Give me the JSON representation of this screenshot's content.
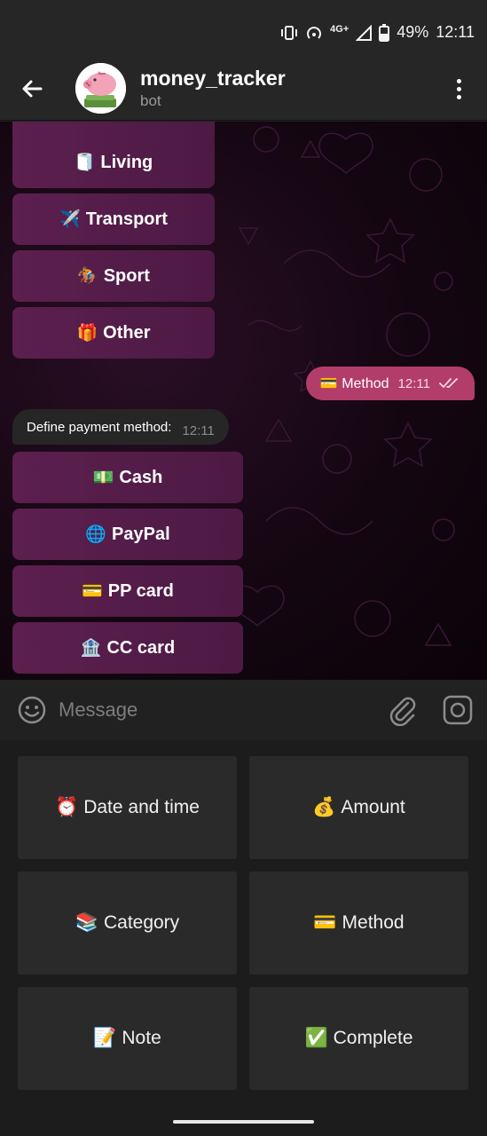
{
  "status_bar": {
    "network": "4G+",
    "battery": "49%",
    "time": "12:11"
  },
  "header": {
    "title": "money_tracker",
    "subtitle": "bot"
  },
  "chat": {
    "category_buttons": [
      {
        "emoji": "🧻",
        "label": "Living"
      },
      {
        "emoji": "✈️",
        "label": "Transport"
      },
      {
        "emoji": "🏇",
        "label": "Sport"
      },
      {
        "emoji": "🎁",
        "label": "Other"
      }
    ],
    "outgoing": {
      "emoji": "💳",
      "text": "Method",
      "time": "12:11"
    },
    "incoming": {
      "text": "Define payment method:",
      "time": "12:11"
    },
    "payment_buttons": [
      {
        "emoji": "💵",
        "label": "Cash"
      },
      {
        "emoji": "🌐",
        "label": "PayPal"
      },
      {
        "emoji": "💳",
        "label": "PP card"
      },
      {
        "emoji": "🏦",
        "label": "CC card"
      }
    ]
  },
  "input": {
    "placeholder": "Message"
  },
  "keyboard": [
    {
      "emoji": "⏰",
      "label": "Date and time"
    },
    {
      "emoji": "💰",
      "label": "Amount"
    },
    {
      "emoji": "📚",
      "label": "Category"
    },
    {
      "emoji": "💳",
      "label": "Method"
    },
    {
      "emoji": "📝",
      "label": "Note"
    },
    {
      "emoji": "✅",
      "label": "Complete"
    }
  ],
  "icons": [
    "back-arrow-icon",
    "piggy-bank-avatar",
    "more-vert-icon",
    "vibrate-icon",
    "hotspot-icon",
    "signal-icon",
    "battery-icon",
    "double-check-icon",
    "emoji-icon",
    "attach-icon",
    "camera-icon"
  ],
  "colors": {
    "outgoing_bubble": "#b33d6a",
    "inline_button": "#5c1f4f",
    "header": "#262626",
    "keyboard_button": "#2a2a2a"
  }
}
